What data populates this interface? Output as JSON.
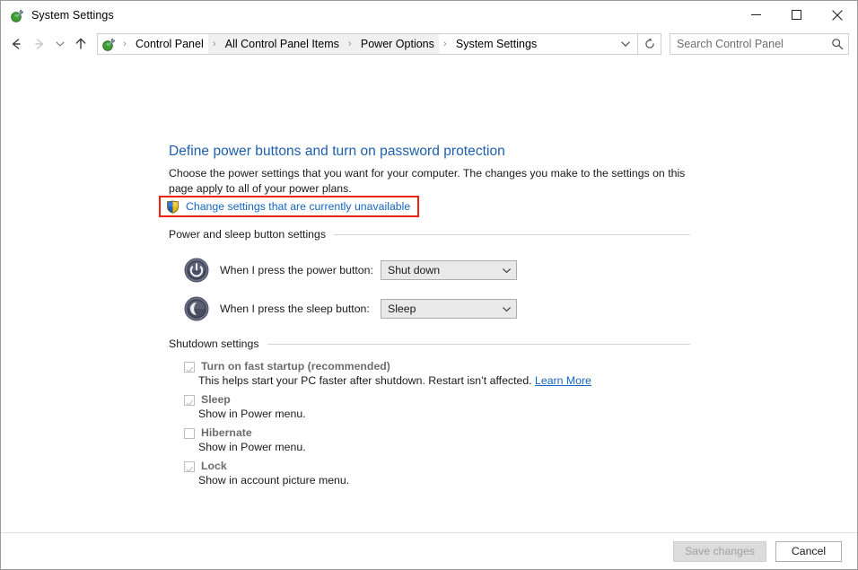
{
  "window": {
    "title": "System Settings",
    "title_icon": "power-options-icon",
    "controls": {
      "minimize": "minimize-icon",
      "maximize": "maximize-icon",
      "close": "close-icon"
    }
  },
  "navbar": {
    "back": "back-arrow-icon",
    "forward": "forward-arrow-icon",
    "recent": "chevron-down-icon",
    "up": "up-arrow-icon",
    "refresh": "refresh-icon",
    "breadcrumbs": [
      {
        "label": "Control Panel",
        "shaded": false
      },
      {
        "label": "All Control Panel Items",
        "shaded": true
      },
      {
        "label": "Power Options",
        "shaded": true
      },
      {
        "label": "System Settings",
        "shaded": false
      }
    ],
    "separator": "›",
    "address_dropdown": "chevron-down-icon"
  },
  "search": {
    "placeholder": "Search Control Panel",
    "value": "",
    "icon": "search-icon"
  },
  "page": {
    "title": "Define power buttons and turn on password protection",
    "description": "Choose the power settings that you want for your computer. The changes you make to the settings on this page apply to all of your power plans.",
    "uac_link": "Change settings that are currently unavailable",
    "uac_icon": "uac-shield-icon",
    "highlight_color": "#ee2211",
    "link_color": "#1466c0",
    "title_color": "#1c5fad"
  },
  "power_section": {
    "header": "Power and sleep button settings",
    "rows": [
      {
        "icon": "power-button-icon",
        "label": "When I press the power button:",
        "value": "Shut down",
        "disabled": true
      },
      {
        "icon": "sleep-button-icon",
        "label": "When I press the sleep button:",
        "value": "Sleep",
        "disabled": true
      }
    ]
  },
  "shutdown_section": {
    "header": "Shutdown settings",
    "items": [
      {
        "label": "Turn on fast startup (recommended)",
        "checked": true,
        "disabled": true,
        "sub": "This helps start your PC faster after shutdown. Restart isn’t affected.",
        "sub_link": "Learn More"
      },
      {
        "label": "Sleep",
        "checked": true,
        "disabled": true,
        "sub": "Show in Power menu.",
        "sub_link": ""
      },
      {
        "label": "Hibernate",
        "checked": false,
        "disabled": true,
        "sub": "Show in Power menu.",
        "sub_link": ""
      },
      {
        "label": "Lock",
        "checked": true,
        "disabled": true,
        "sub": "Show in account picture menu.",
        "sub_link": ""
      }
    ]
  },
  "footer": {
    "save_label": "Save changes",
    "save_disabled": true,
    "cancel_label": "Cancel"
  }
}
